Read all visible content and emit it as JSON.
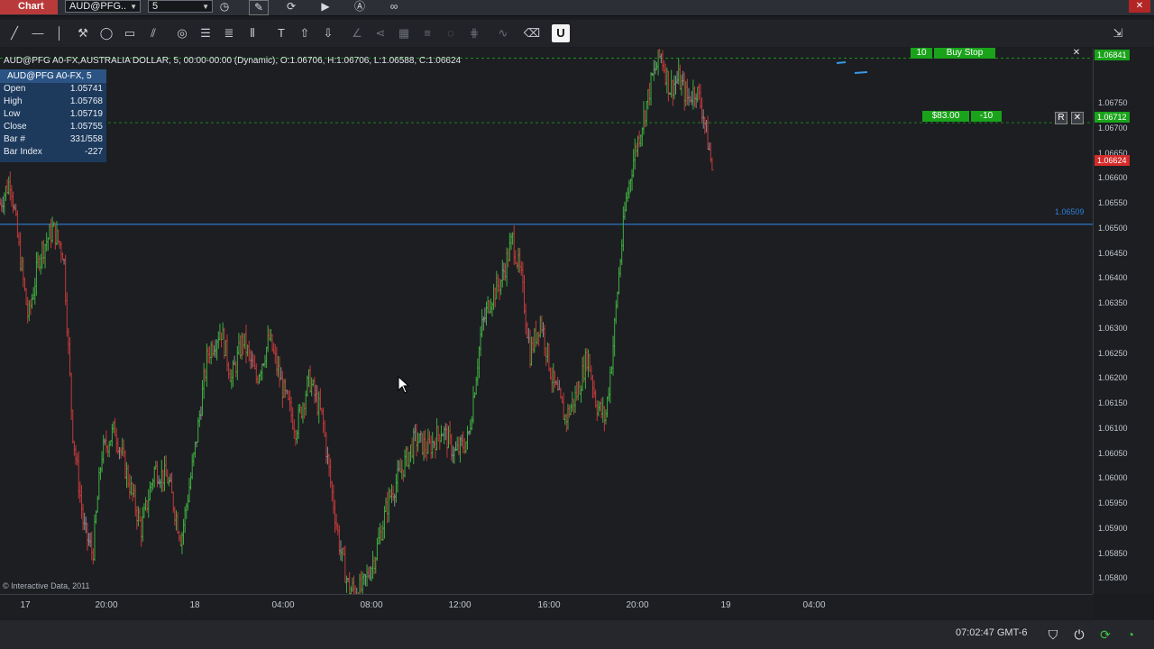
{
  "titlebar": {
    "tab_label": "Chart",
    "instrument_value": "AUD@PFG..",
    "interval_value": "5",
    "close_label": "✕"
  },
  "chart_header": "AUD@PFG A0-FX,AUSTRALIA DOLLAR, 5, 00:00-00:00 (Dynamic), O:1.06706, H:1.06706, L:1.06588, C:1.06624",
  "info_panel": {
    "title": "AUD@PFG A0-FX, 5",
    "rows": [
      {
        "key": "Open",
        "value": "1.05741"
      },
      {
        "key": "High",
        "value": "1.05768"
      },
      {
        "key": "Low",
        "value": "1.05719"
      },
      {
        "key": "Close",
        "value": "1.05755"
      },
      {
        "key": "Bar #",
        "value": "331/558"
      },
      {
        "key": "Bar Index",
        "value": "-227"
      }
    ]
  },
  "orders": {
    "buy_stop_qty": "10",
    "buy_stop_label": "Buy Stop",
    "position_pnl": "$83.00",
    "position_qty": "-10",
    "reverse_label": "R",
    "close_label": "✕"
  },
  "copyright": "© Interactive Data, 2011",
  "y_axis": {
    "labels": [
      "1.06750",
      "1.06700",
      "1.06650",
      "1.06600",
      "1.06550",
      "1.06500",
      "1.06450",
      "1.06400",
      "1.06350",
      "1.06300",
      "1.06250",
      "1.06200",
      "1.06150",
      "1.06100",
      "1.06050",
      "1.06000",
      "1.05950",
      "1.05900",
      "1.05850",
      "1.05800"
    ],
    "tag_buy_stop": "1.06841",
    "tag_position": "1.06712",
    "tag_last": "1.06624",
    "hline_value": "1.06509"
  },
  "x_axis": {
    "labels": [
      "17",
      "20:00",
      "18",
      "04:00",
      "08:00",
      "12:00",
      "16:00",
      "20:00",
      "19",
      "04:00"
    ]
  },
  "status": {
    "clock": "07:02:47 GMT-6"
  },
  "colors": {
    "up": "#3fae3f",
    "down": "#c23a3a",
    "neutral": "#8a8d92",
    "hline": "#2f7fd8",
    "order_green": "#1aa31a",
    "last_price": "#d42b2b"
  },
  "chart_data": {
    "type": "candlestick",
    "ylim": [
      1.0577,
      1.0686
    ],
    "x_ticks": [
      "17",
      "20:00",
      "18",
      "04:00",
      "08:00",
      "12:00",
      "16:00",
      "20:00",
      "19",
      "04:00"
    ],
    "horizontal_lines": [
      {
        "value": 1.06841,
        "style": "dashed",
        "color": "#1aa31a"
      },
      {
        "value": 1.06712,
        "style": "dashed",
        "color": "#1aa31a"
      },
      {
        "value": 1.06509,
        "style": "solid",
        "color": "#2f7fd8"
      }
    ],
    "price_path": [
      [
        0.0,
        1.0655
      ],
      [
        0.012,
        1.066
      ],
      [
        0.02,
        1.0648
      ],
      [
        0.032,
        1.0632
      ],
      [
        0.045,
        1.0645
      ],
      [
        0.06,
        1.065
      ],
      [
        0.072,
        1.0645
      ],
      [
        0.082,
        1.061
      ],
      [
        0.095,
        1.059
      ],
      [
        0.105,
        1.0585
      ],
      [
        0.115,
        1.0605
      ],
      [
        0.13,
        1.061
      ],
      [
        0.145,
        1.06
      ],
      [
        0.16,
        1.059
      ],
      [
        0.175,
        1.0602
      ],
      [
        0.19,
        1.06
      ],
      [
        0.205,
        1.0588
      ],
      [
        0.22,
        1.0605
      ],
      [
        0.235,
        1.0625
      ],
      [
        0.25,
        1.063
      ],
      [
        0.262,
        1.062
      ],
      [
        0.275,
        1.0628
      ],
      [
        0.29,
        1.062
      ],
      [
        0.305,
        1.0628
      ],
      [
        0.32,
        1.0618
      ],
      [
        0.335,
        1.061
      ],
      [
        0.35,
        1.062
      ],
      [
        0.365,
        1.0612
      ],
      [
        0.375,
        1.0598
      ],
      [
        0.385,
        1.0586
      ],
      [
        0.395,
        1.0578
      ],
      [
        0.41,
        1.0578
      ],
      [
        0.425,
        1.0585
      ],
      [
        0.44,
        1.0596
      ],
      [
        0.455,
        1.0602
      ],
      [
        0.47,
        1.0608
      ],
      [
        0.485,
        1.0606
      ],
      [
        0.5,
        1.061
      ],
      [
        0.515,
        1.0605
      ],
      [
        0.53,
        1.0608
      ],
      [
        0.545,
        1.063
      ],
      [
        0.555,
        1.0636
      ],
      [
        0.568,
        1.064
      ],
      [
        0.58,
        1.0648
      ],
      [
        0.59,
        1.064
      ],
      [
        0.6,
        1.0625
      ],
      [
        0.612,
        1.0632
      ],
      [
        0.625,
        1.062
      ],
      [
        0.64,
        1.0612
      ],
      [
        0.655,
        1.0618
      ],
      [
        0.665,
        1.0625
      ],
      [
        0.675,
        1.0615
      ],
      [
        0.685,
        1.0612
      ],
      [
        0.693,
        1.0625
      ],
      [
        0.7,
        1.064
      ],
      [
        0.708,
        1.0655
      ],
      [
        0.718,
        1.0665
      ],
      [
        0.728,
        1.0672
      ],
      [
        0.738,
        1.068
      ],
      [
        0.748,
        1.0685
      ],
      [
        0.758,
        1.0678
      ],
      [
        0.768,
        1.068
      ],
      [
        0.778,
        1.0676
      ],
      [
        0.788,
        1.0678
      ],
      [
        0.796,
        1.0673
      ],
      [
        0.806,
        1.0662
      ]
    ]
  }
}
